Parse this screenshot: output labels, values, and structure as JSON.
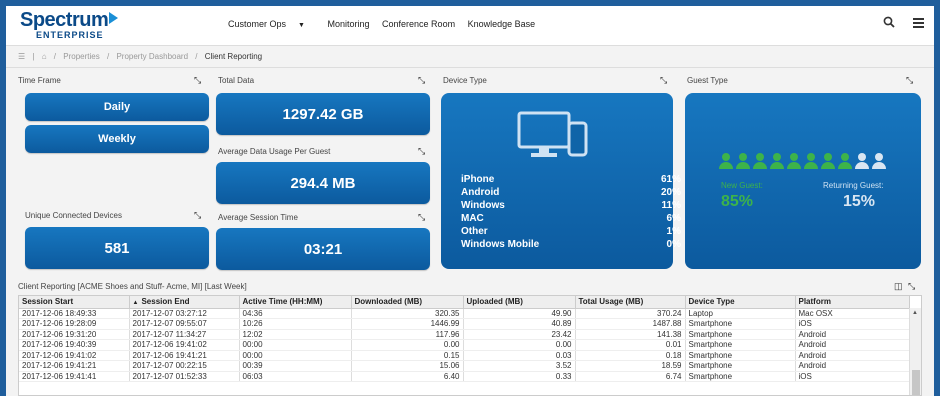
{
  "header": {
    "logo_line1": "Spectrum",
    "logo_line2": "ENTERPRISE",
    "nav": [
      "Customer Ops",
      "Monitoring",
      "Conference Room",
      "Knowledge Base"
    ],
    "search_icon": "search-icon",
    "menu_icon": "hamburger-icon"
  },
  "breadcrumb": {
    "items": [
      "Properties",
      "Property Dashboard",
      "Client Reporting"
    ]
  },
  "time_frame": {
    "title": "Time Frame",
    "buttons": [
      "Daily",
      "Weekly"
    ]
  },
  "total_data": {
    "title": "Total Data",
    "value": "1297.42 GB"
  },
  "avg_usage": {
    "title": "Average Data Usage Per Guest",
    "value": "294.4 MB"
  },
  "unique_devices": {
    "title": "Unique Connected Devices",
    "value": "581"
  },
  "avg_session": {
    "title": "Average Session Time",
    "value": "03:21"
  },
  "device_type": {
    "title": "Device Type",
    "rows": [
      {
        "name": "iPhone",
        "pct": "61%"
      },
      {
        "name": "Android",
        "pct": "20%"
      },
      {
        "name": "Windows",
        "pct": "11%"
      },
      {
        "name": "MAC",
        "pct": "6%"
      },
      {
        "name": "Other",
        "pct": "1%"
      },
      {
        "name": "Windows Mobile",
        "pct": "0%"
      }
    ]
  },
  "guest_type": {
    "title": "Guest Type",
    "new_label": "New Guest:",
    "new_value": "85%",
    "returning_label": "Returning Guest:",
    "returning_value": "15%",
    "colors": {
      "new": "#3db34a",
      "returning": "#d9e6f2"
    }
  },
  "client_reporting": {
    "title": "Client Reporting  [ACME Shoes and Stuff- Acme, MI] [Last Week]",
    "columns": [
      "Session Start",
      "Session End",
      "Active Time (HH:MM)",
      "Downloaded (MB)",
      "Uploaded (MB)",
      "Total Usage (MB)",
      "Device Type",
      "Platform"
    ],
    "sort_indicator": "▲",
    "rows": [
      [
        "2017-12-06 18:49:33",
        "2017-12-07 03:27:12",
        "04:36",
        "320.35",
        "49.90",
        "370.24",
        "Laptop",
        "Mac OSX"
      ],
      [
        "2017-12-06 19:28:09",
        "2017-12-07 09:55:07",
        "10:26",
        "1446.99",
        "40.89",
        "1487.88",
        "Smartphone",
        "iOS"
      ],
      [
        "2017-12-06 19:31:20",
        "2017-12-07 11:34:27",
        "12:02",
        "117.96",
        "23.42",
        "141.38",
        "Smartphone",
        "Android"
      ],
      [
        "2017-12-06 19:40:39",
        "2017-12-06 19:41:02",
        "00:00",
        "0.00",
        "0.00",
        "0.01",
        "Smartphone",
        "Android"
      ],
      [
        "2017-12-06 19:41:02",
        "2017-12-06 19:41:21",
        "00:00",
        "0.15",
        "0.03",
        "0.18",
        "Smartphone",
        "Android"
      ],
      [
        "2017-12-06 19:41:21",
        "2017-12-07 00:22:15",
        "00:39",
        "15.06",
        "3.52",
        "18.59",
        "Smartphone",
        "Android"
      ],
      [
        "2017-12-06 19:41:41",
        "2017-12-07 01:52:33",
        "06:03",
        "6.40",
        "0.33",
        "6.74",
        "Smartphone",
        "iOS"
      ]
    ]
  },
  "colors": {
    "brand": "#0b4a88",
    "tile": "#0c5a9e",
    "frame": "#1f5e9c"
  }
}
